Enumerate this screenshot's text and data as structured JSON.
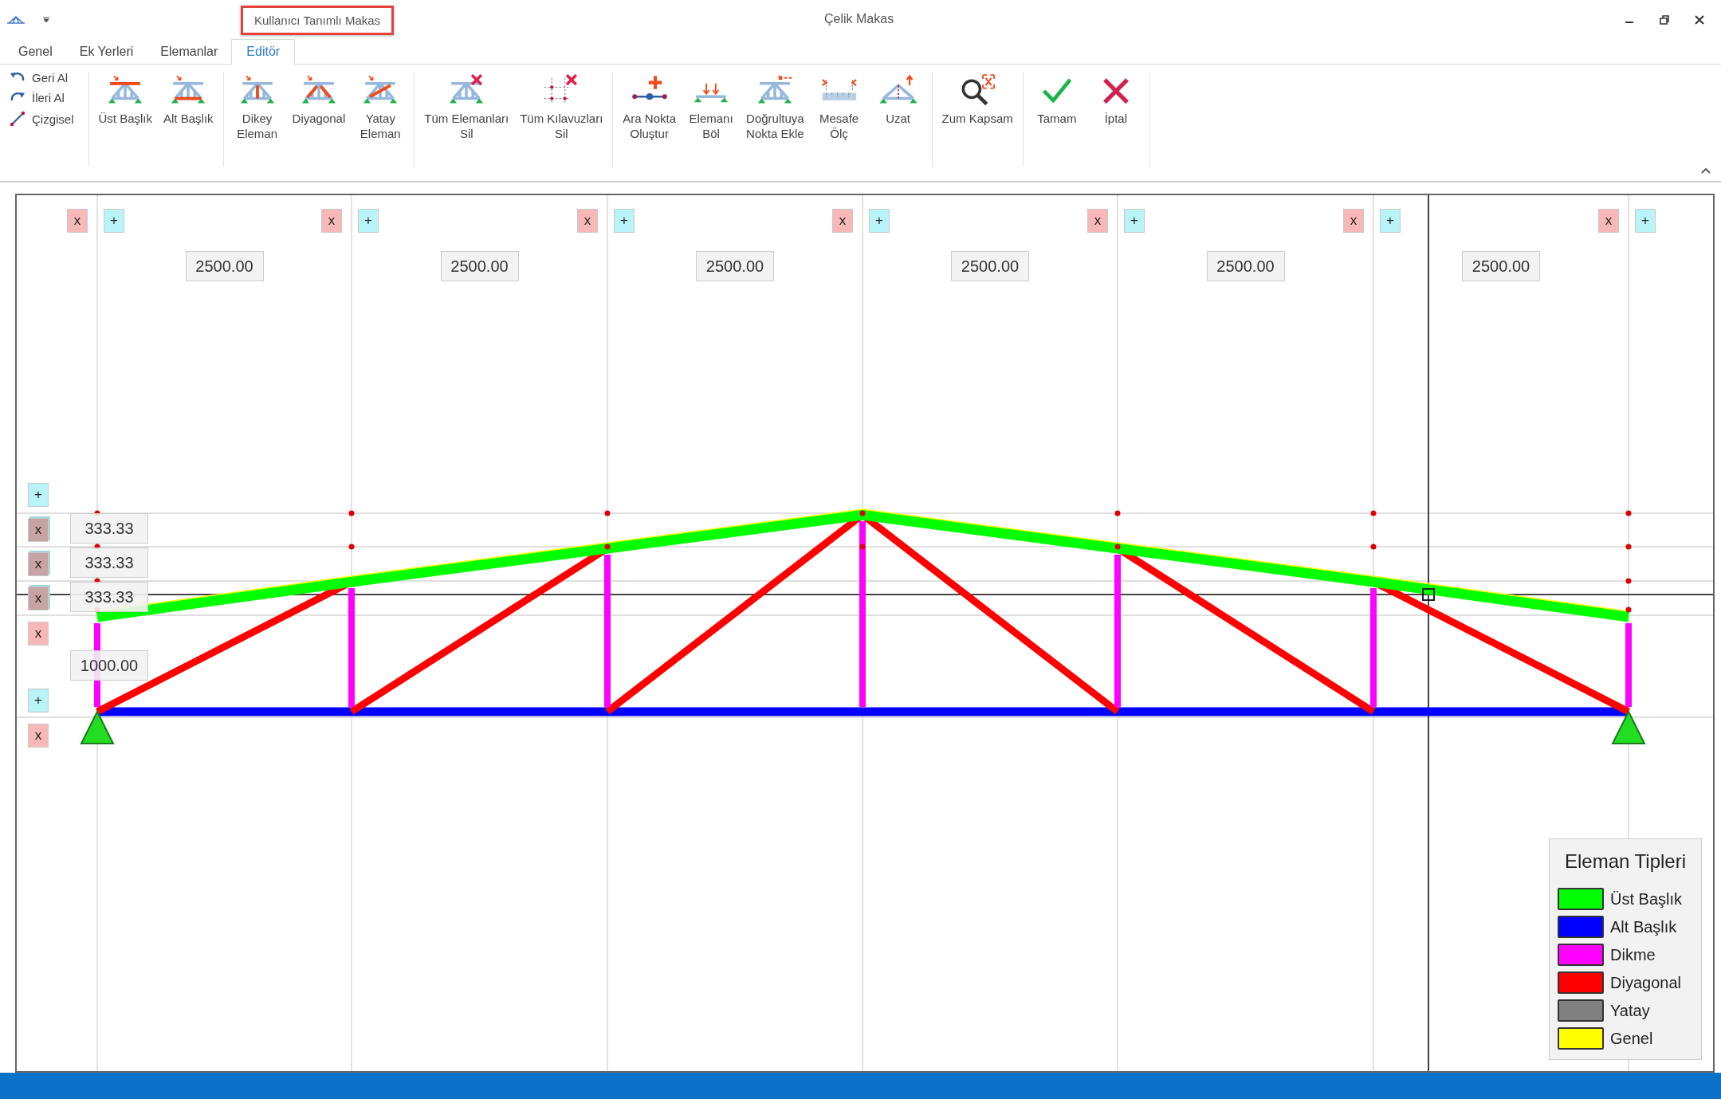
{
  "window": {
    "title": "Çelik Makas",
    "document_tab": "Kullanıcı Tanımlı Makas"
  },
  "tabs": [
    {
      "label": "Genel",
      "selected": false
    },
    {
      "label": "Ek Yerleri",
      "selected": false
    },
    {
      "label": "Elemanlar",
      "selected": false
    },
    {
      "label": "Editör",
      "selected": true
    }
  ],
  "history": [
    {
      "kind": "undo",
      "label": "Geri Al"
    },
    {
      "kind": "redo",
      "label": "İleri Al"
    },
    {
      "kind": "line",
      "label": "Çizgisel"
    }
  ],
  "ribbon_groups": [
    [
      {
        "kind": "top",
        "label": "Üst Başlık"
      },
      {
        "kind": "bottom",
        "label": "Alt Başlık"
      }
    ],
    [
      {
        "kind": "vertical",
        "label": "Dikey\nEleman"
      },
      {
        "kind": "diagonal",
        "label": "Diyagonal"
      },
      {
        "kind": "horizontal",
        "label": "Yatay\nEleman"
      }
    ],
    [
      {
        "kind": "delete-all",
        "label": "Tüm Elemanları\nSil"
      },
      {
        "kind": "delete-guides",
        "label": "Tüm Kılavuzları\nSil"
      }
    ],
    [
      {
        "kind": "add-point",
        "label": "Ara Nokta\nOluştur"
      },
      {
        "kind": "split",
        "label": "Elemanı\nBöl"
      },
      {
        "kind": "point-on-line",
        "label": "Doğrultuya\nNokta Ekle"
      },
      {
        "kind": "measure",
        "label": "Mesafe\nÖlç"
      },
      {
        "kind": "extend",
        "label": "Uzat"
      }
    ],
    [
      {
        "kind": "zoom",
        "label": "Zum Kapsam"
      }
    ],
    [
      {
        "kind": "ok",
        "label": "Tamam"
      },
      {
        "kind": "cancel",
        "label": "İptal"
      }
    ]
  ],
  "canvas": {
    "column_markers": [
      {
        "remove": "x",
        "add": "+"
      },
      {
        "remove": "x",
        "add": "+"
      },
      {
        "remove": "x",
        "add": "+"
      },
      {
        "remove": "x",
        "add": "+"
      },
      {
        "remove": "x",
        "add": "+"
      },
      {
        "remove": "x",
        "add": "+"
      },
      {
        "remove": "x",
        "add": "+"
      }
    ],
    "column_dimensions": [
      "2500.00",
      "2500.00",
      "2500.00",
      "2500.00",
      "2500.00",
      "2500.00"
    ],
    "row_buttons": [
      {
        "kind": "add",
        "text": "+"
      },
      {
        "kind": "remove-stacked",
        "text": "x"
      },
      {
        "kind": "remove-stacked",
        "text": "x"
      },
      {
        "kind": "remove-stacked",
        "text": "x"
      },
      {
        "kind": "remove",
        "text": "x"
      },
      {
        "kind": "add",
        "text": "+"
      },
      {
        "kind": "remove",
        "text": "x"
      }
    ],
    "row_dimensions": [
      "333.33",
      "333.33",
      "333.33",
      "1000.00"
    ]
  },
  "legend": {
    "title": "Eleman Tipleri",
    "items": [
      {
        "kind": "top",
        "label": "Üst Başlık",
        "color": "#00ff00"
      },
      {
        "kind": "bottom",
        "label": "Alt Başlık",
        "color": "#0000ff"
      },
      {
        "kind": "vertical",
        "label": "Dikme",
        "color": "#ff00ff"
      },
      {
        "kind": "diagonal",
        "label": "Diyagonal",
        "color": "#ff0000"
      },
      {
        "kind": "horizontal",
        "label": "Yatay",
        "color": "#808080"
      },
      {
        "kind": "general",
        "label": "Genel",
        "color": "#ffff00"
      }
    ]
  }
}
